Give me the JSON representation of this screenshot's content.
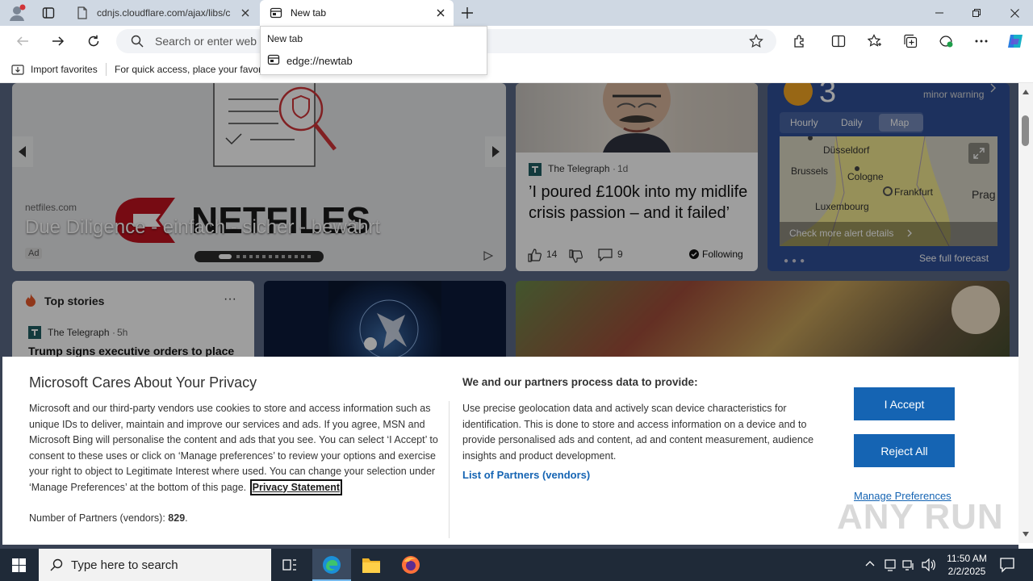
{
  "browser": {
    "tabs": [
      {
        "title": "cdnjs.cloudflare.com/ajax/libs/c",
        "active": false
      },
      {
        "title": "New tab",
        "active": true
      }
    ],
    "address_placeholder": "Search or enter web a",
    "favorites": {
      "import_label": "Import favorites",
      "hint_text": "For quick access, place your favori"
    },
    "dropdown": {
      "title": "New tab",
      "url": "edge://newtab"
    }
  },
  "feed": {
    "ad": {
      "source": "netfiles.com",
      "headline": "Due Diligence - einfach - sicher - bewährt",
      "logo_text": "NETFILES",
      "ad_label": "Ad"
    },
    "news": {
      "publisher": "The Telegraph",
      "age": "1d",
      "headline": "’I poured £100k into my midlife crisis passion – and it failed’",
      "likes": "14",
      "comments": "9",
      "following_label": "Following"
    },
    "weather": {
      "temp": "3",
      "alert": "minor warning",
      "tabs": [
        "Hourly",
        "Daily",
        "Map"
      ],
      "active_tab": "Map",
      "cities": [
        "Düsseldorf",
        "Brussels",
        "Cologne",
        "Frankfurt",
        "Luxembourg",
        "Prag"
      ],
      "alert_link": "Check more alert details",
      "forecast_link": "See full forecast"
    },
    "top_stories": {
      "title": "Top stories",
      "publisher": "The Telegraph",
      "age": "5h",
      "headline": "Trump signs executive orders to place"
    }
  },
  "privacy": {
    "title": "Microsoft Cares About Your Privacy",
    "body": "Microsoft and our third-party vendors use cookies to store and access information such as unique IDs to deliver, maintain and improve our services and ads. If you agree, MSN and Microsoft Bing will personalise the content and ads that you see. You can select ‘I Accept’ to consent to these uses or click on ‘Manage preferences’ to review your options and exercise your right to object to Legitimate Interest where used.  You can change your selection under ‘Manage Preferences’ at the bottom of this page.",
    "privacy_link": "Privacy Statement",
    "partners_label": "Number of Partners (vendors):",
    "partners_count": "829",
    "right_title": "We and our partners process data to provide:",
    "right_body": "Use precise geolocation data and actively scan device characteristics for identification. This is done to store and access information on a device and to provide personalised ads and content, ad and content measurement, audience insights and product development.",
    "partners_link": "List of Partners (vendors)",
    "accept": "I Accept",
    "reject": "Reject All",
    "manage": "Manage Preferences"
  },
  "taskbar": {
    "search_placeholder": "Type here to search",
    "time": "11:50 AM",
    "date": "2/2/2025"
  },
  "watermark": "ANY RUN",
  "colors": {
    "accent": "#1564b3",
    "taskbar": "#1f2a38",
    "titlebar": "#cfd8e3"
  }
}
